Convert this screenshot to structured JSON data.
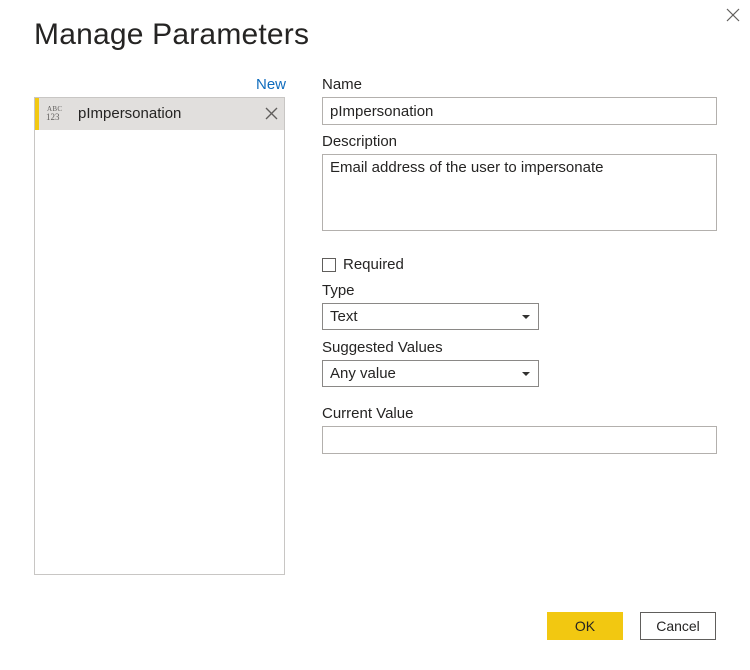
{
  "dialog": {
    "title": "Manage Parameters",
    "close_icon": "close-icon"
  },
  "list": {
    "new_label": "New",
    "items": [
      {
        "name": "pImpersonation",
        "type_icon": "abc-123-type-icon",
        "type_icon_top": "ABC",
        "type_icon_bottom": "123",
        "selected": true,
        "remove_icon": "remove-icon"
      }
    ]
  },
  "form": {
    "name_label": "Name",
    "name_value": "pImpersonation",
    "description_label": "Description",
    "description_value": "Email address of the user to impersonate",
    "required_label": "Required",
    "required_checked": false,
    "type_label": "Type",
    "type_value": "Text",
    "suggested_label": "Suggested Values",
    "suggested_value": "Any value",
    "current_label": "Current Value",
    "current_value": ""
  },
  "buttons": {
    "ok_label": "OK",
    "cancel_label": "Cancel"
  },
  "colors": {
    "accent": "#f2c811",
    "link": "#0f6cbd",
    "selected_bg": "#e1dfdd"
  }
}
